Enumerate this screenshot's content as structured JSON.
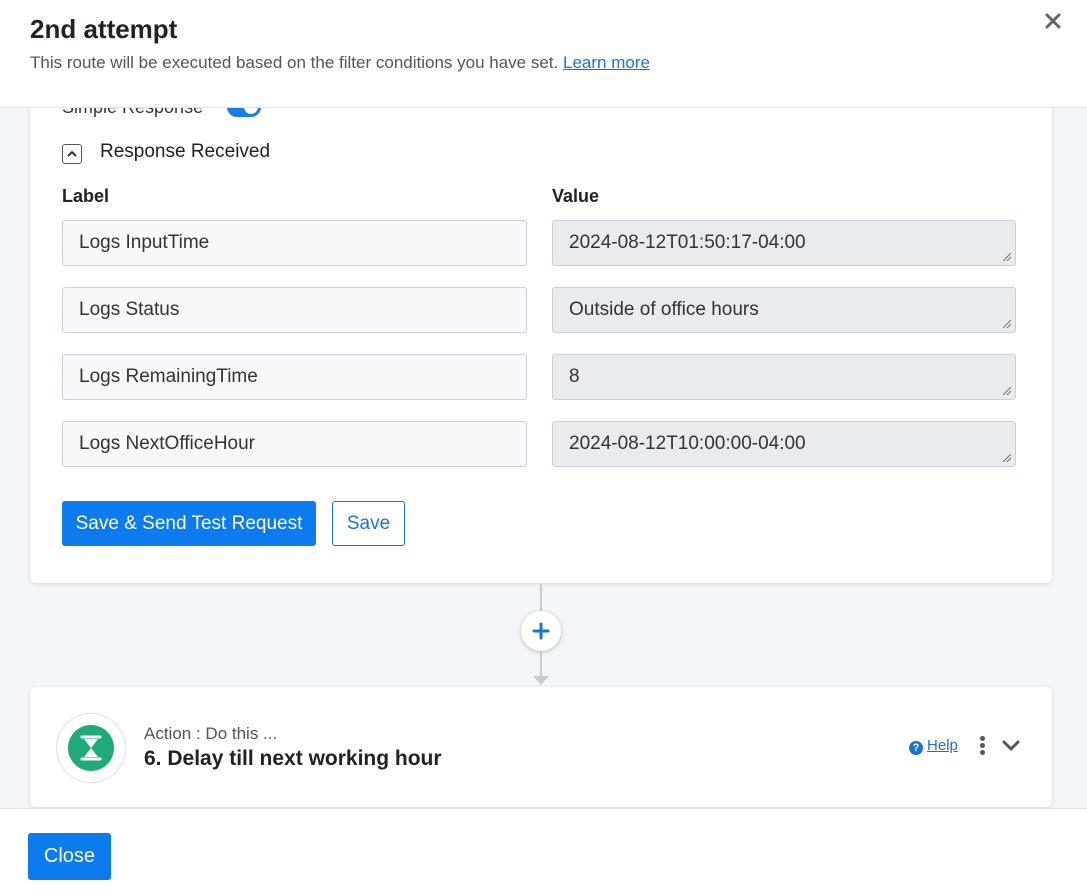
{
  "header": {
    "title": "2nd attempt",
    "subtitle": "This route will be executed based on the filter conditions you have set.",
    "learn_more": "Learn more"
  },
  "response": {
    "simple_response_label": "Simple Response",
    "section_title": "Response Received",
    "col_label": "Label",
    "col_value": "Value",
    "rows": [
      {
        "label": "Logs InputTime",
        "value": "2024-08-12T01:50:17-04:00"
      },
      {
        "label": "Logs Status",
        "value": "Outside of office hours"
      },
      {
        "label": "Logs RemainingTime",
        "value": "8"
      },
      {
        "label": "Logs NextOfficeHour",
        "value": "2024-08-12T10:00:00-04:00"
      }
    ],
    "save_send_label": "Save & Send Test Request",
    "save_label": "Save"
  },
  "action": {
    "subtitle": "Action : Do this ...",
    "title": "6. Delay till next working hour",
    "help_label": "Help",
    "icon": "hourglass-icon"
  },
  "footer": {
    "close_label": "Close"
  },
  "colors": {
    "primary": "#0b7bee",
    "link": "#1b73d1",
    "app_icon_bg": "#1faa7a"
  }
}
